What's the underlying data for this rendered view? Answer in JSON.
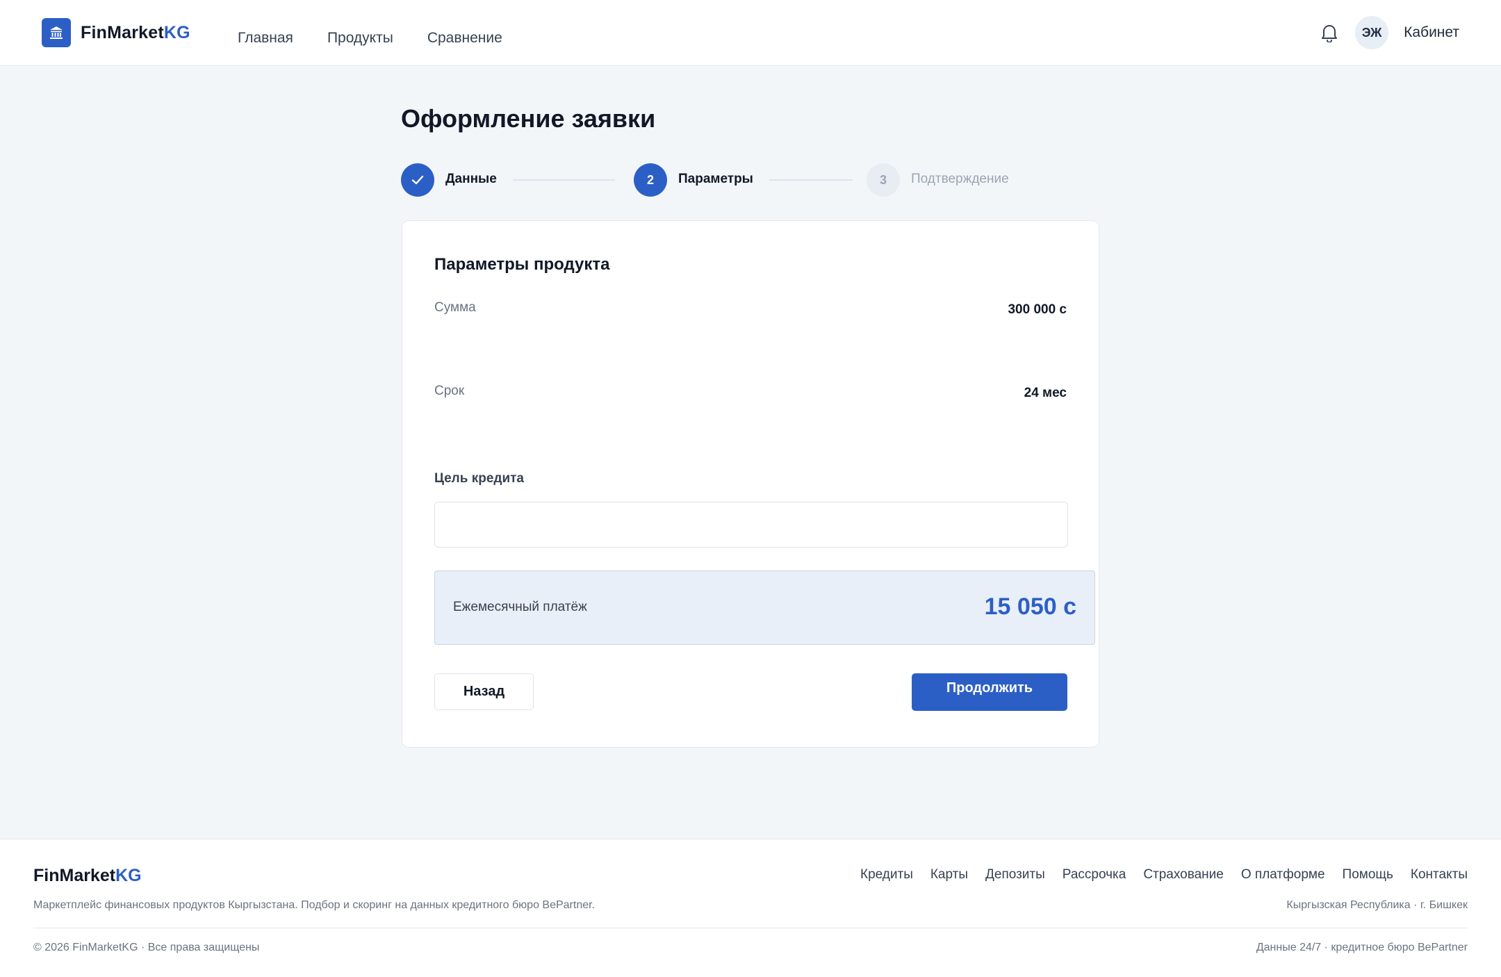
{
  "header": {
    "logo_main": "FinMarket",
    "logo_accent": "KG",
    "nav": [
      "Главная",
      "Продукты",
      "Сравнение"
    ],
    "avatar_initials": "ЭЖ",
    "cabinet_label": "Кабинет"
  },
  "page": {
    "title": "Оформление заявки"
  },
  "stepper": {
    "steps": [
      {
        "number": "1",
        "label": "Данные",
        "state": "done"
      },
      {
        "number": "2",
        "label": "Параметры",
        "state": "active"
      },
      {
        "number": "3",
        "label": "Подтверждение",
        "state": "pending"
      }
    ]
  },
  "card": {
    "title": "Параметры продукта",
    "amount_label": "Сумма",
    "amount_value": "300 000 с",
    "term_label": "Срок",
    "term_value": "24 мес",
    "purpose_label": "Цель кредита",
    "purpose_value": "",
    "purpose_placeholder": "",
    "payment_label": "Ежемесячный платёж",
    "payment_value": "15 050 с",
    "back_label": "Назад",
    "continue_label": "Продолжить"
  },
  "footer": {
    "logo_main": "FinMarket",
    "logo_accent": "KG",
    "links": [
      "Кредиты",
      "Карты",
      "Депозиты",
      "Рассрочка",
      "Страхование",
      "О платформе",
      "Помощь",
      "Контакты"
    ],
    "description": "Маркетплейс финансовых продуктов Кыргызстана. Подбор и скоринг на данных кредитного бюро BePartner.",
    "location": "Кыргызская Республика · г. Бишкек",
    "copyright": "© 2026 FinMarketKG · Все права защищены",
    "data_source": "Данные 24/7 · кредитное бюро BePartner"
  },
  "colors": {
    "accent": "#2c5fc6",
    "background": "#f3f6f9",
    "payment_box": "#e9eff8"
  },
  "icons": {
    "logo": "bank-building-icon",
    "notifications": "bell-icon",
    "step_done": "check-icon"
  }
}
